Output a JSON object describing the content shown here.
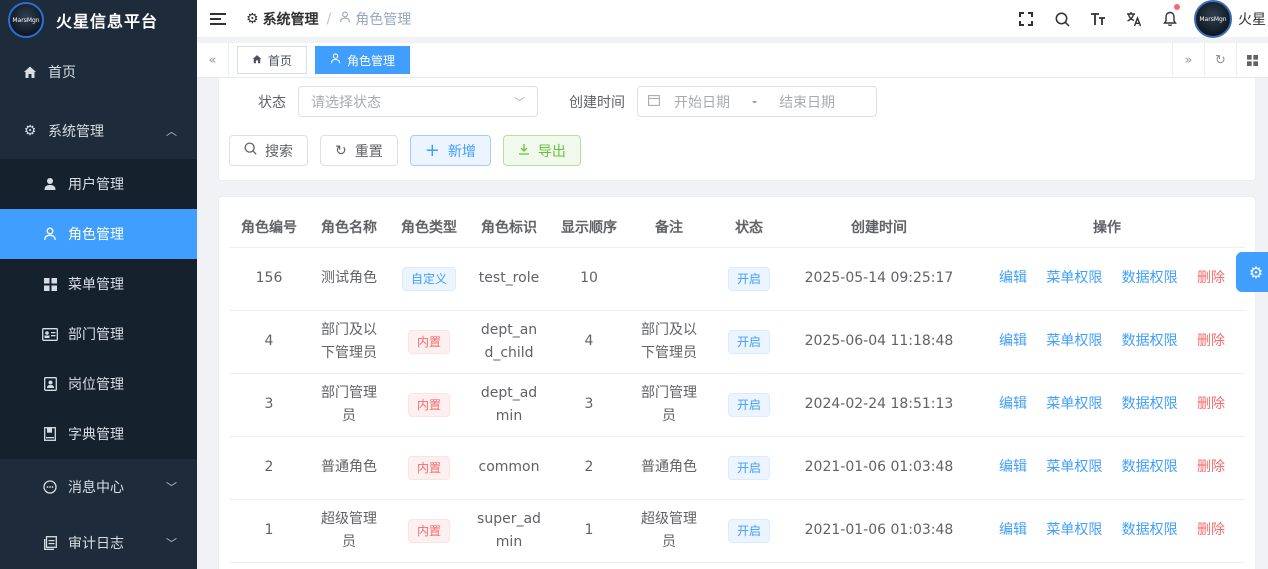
{
  "brand": {
    "title": "火星信息平台",
    "logo_text": "MarsMgn"
  },
  "sidebar": {
    "items": [
      {
        "label": "首页",
        "icon": "home-icon"
      },
      {
        "label": "系统管理",
        "icon": "gear-icon",
        "expanded": true
      },
      {
        "label": "用户管理",
        "icon": "user-icon"
      },
      {
        "label": "角色管理",
        "icon": "person-outline-icon",
        "active": true
      },
      {
        "label": "菜单管理",
        "icon": "grid-icon"
      },
      {
        "label": "部门管理",
        "icon": "id-card-icon"
      },
      {
        "label": "岗位管理",
        "icon": "badge-icon"
      },
      {
        "label": "字典管理",
        "icon": "book-icon"
      },
      {
        "label": "消息中心",
        "icon": "chat-icon"
      },
      {
        "label": "审计日志",
        "icon": "log-icon"
      }
    ]
  },
  "header": {
    "breadcrumb": {
      "parent": "系统管理",
      "current": "角色管理"
    },
    "user_name": "火星"
  },
  "tags": [
    {
      "label": "首页"
    },
    {
      "label": "角色管理",
      "active": true
    }
  ],
  "search": {
    "status_label": "状态",
    "status_placeholder": "请选择状态",
    "created_label": "创建时间",
    "start_placeholder": "开始日期",
    "date_sep": "-",
    "end_placeholder": "结束日期",
    "buttons": {
      "search": "搜索",
      "reset": "重置",
      "add": "新增",
      "export": "导出"
    }
  },
  "table": {
    "headers": [
      "角色编号",
      "角色名称",
      "角色类型",
      "角色标识",
      "显示顺序",
      "备注",
      "状态",
      "创建时间",
      "操作"
    ],
    "rows": [
      {
        "id": "156",
        "name": "测试角色",
        "type": "自定义",
        "type_kind": "custom",
        "key": "test_role",
        "order": "10",
        "remark": "",
        "status": "开启",
        "created": "2025-05-14 09:25:17"
      },
      {
        "id": "4",
        "name": "部门及以下管理员",
        "type": "内置",
        "type_kind": "builtin",
        "key": "dept_and_child",
        "order": "4",
        "remark": "部门及以下管理员",
        "status": "开启",
        "created": "2025-06-04 11:18:48"
      },
      {
        "id": "3",
        "name": "部门管理员",
        "type": "内置",
        "type_kind": "builtin",
        "key": "dept_admin",
        "order": "3",
        "remark": "部门管理员",
        "status": "开启",
        "created": "2024-02-24 18:51:13"
      },
      {
        "id": "2",
        "name": "普通角色",
        "type": "内置",
        "type_kind": "builtin",
        "key": "common",
        "order": "2",
        "remark": "普通角色",
        "status": "开启",
        "created": "2021-01-06 01:03:48"
      },
      {
        "id": "1",
        "name": "超级管理员",
        "type": "内置",
        "type_kind": "builtin",
        "key": "super_admin",
        "order": "1",
        "remark": "超级管理员",
        "status": "开启",
        "created": "2021-01-06 01:03:48"
      }
    ],
    "ops": {
      "edit": "编辑",
      "menu_perm": "菜单权限",
      "data_perm": "数据权限",
      "delete": "删除"
    }
  },
  "colors": {
    "primary": "#409eff",
    "danger": "#f56c6c",
    "success": "#67c23a",
    "sidebar_bg": "#1d2b3a"
  }
}
